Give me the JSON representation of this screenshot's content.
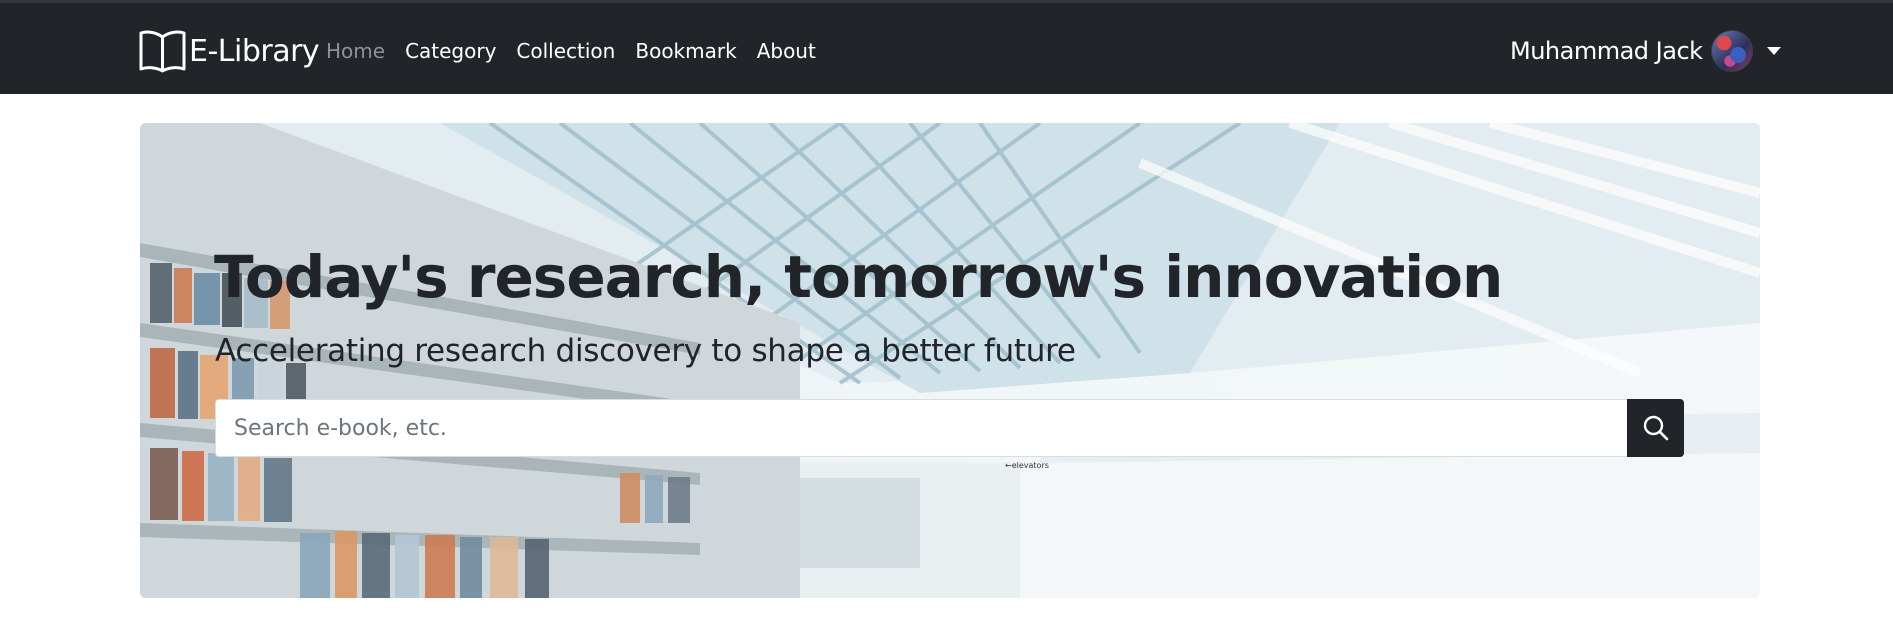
{
  "navbar": {
    "brand": {
      "icon": "open-book-icon",
      "text": "E-Library"
    },
    "links": [
      {
        "label": "Home",
        "active": true
      },
      {
        "label": "Category",
        "active": false
      },
      {
        "label": "Collection",
        "active": false
      },
      {
        "label": "Bookmark",
        "active": false
      },
      {
        "label": "About",
        "active": false
      }
    ],
    "user": {
      "name": "Muhammad Jack",
      "avatar": "user-avatar",
      "menu_icon": "caret-down-icon"
    }
  },
  "hero": {
    "title": "Today's research, tomorrow's innovation",
    "subtitle": "Accelerating research discovery to shape a better future",
    "background_sign": "←elevators",
    "search": {
      "placeholder": "Search e-book, etc.",
      "value": "",
      "button_icon": "search-icon"
    }
  },
  "colors": {
    "navbar_bg": "#212529",
    "active_link": "#8c9198",
    "link": "#ffffff",
    "search_button_bg": "#212529"
  }
}
